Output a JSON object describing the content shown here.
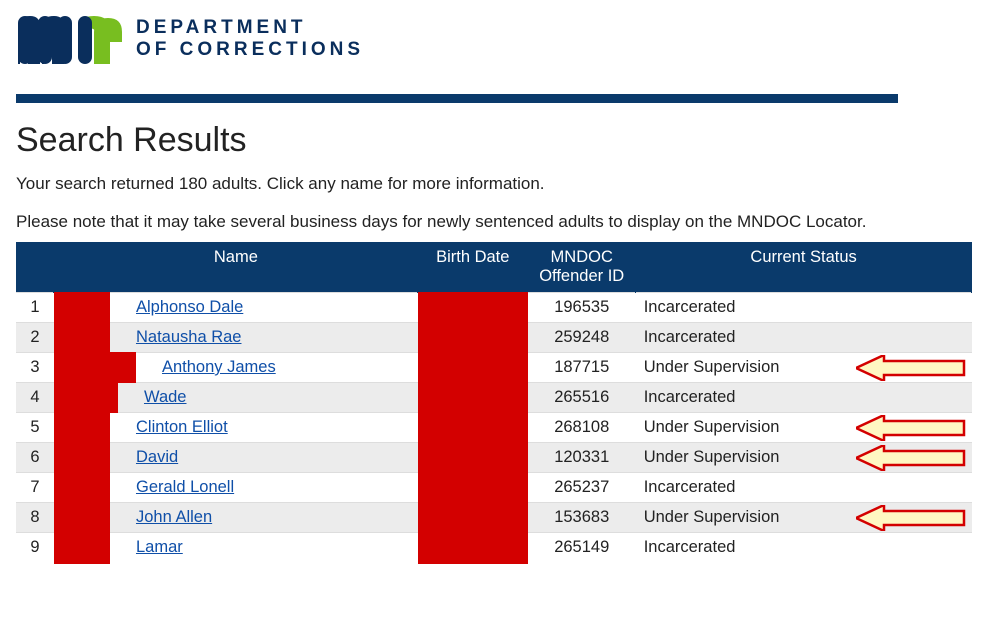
{
  "header": {
    "dept_line1": "DEPARTMENT",
    "dept_line2": "OF CORRECTIONS"
  },
  "page_title": "Search Results",
  "summary_text": "Your search returned 180 adults. Click any name for more information.",
  "note_text": "Please note that it may take several business days for newly sentenced adults to display on the MNDOC Locator.",
  "columns": {
    "name": "Name",
    "birth_date": "Birth Date",
    "offender_id": "MNDOC Offender ID",
    "status": "Current Status"
  },
  "rows": [
    {
      "n": "1",
      "name": "Alphonso Dale",
      "redact_w": 56,
      "link_ml": 74,
      "oid": "196535",
      "status": "Incarcerated",
      "arrow": false
    },
    {
      "n": "2",
      "name": "Natausha Rae",
      "redact_w": 56,
      "link_ml": 74,
      "oid": "259248",
      "status": "Incarcerated",
      "arrow": false
    },
    {
      "n": "3",
      "name": "Anthony James",
      "redact_w": 82,
      "link_ml": 100,
      "oid": "187715",
      "status": "Under Supervision",
      "arrow": true
    },
    {
      "n": "4",
      "name": "Wade",
      "redact_w": 64,
      "link_ml": 82,
      "oid": "265516",
      "status": "Incarcerated",
      "arrow": false
    },
    {
      "n": "5",
      "name": "Clinton Elliot",
      "redact_w": 56,
      "link_ml": 74,
      "oid": "268108",
      "status": "Under Supervision",
      "arrow": true
    },
    {
      "n": "6",
      "name": "David",
      "redact_w": 56,
      "link_ml": 74,
      "oid": "120331",
      "status": "Under Supervision",
      "arrow": true
    },
    {
      "n": "7",
      "name": "Gerald Lonell",
      "redact_w": 56,
      "link_ml": 74,
      "oid": "265237",
      "status": "Incarcerated",
      "arrow": false
    },
    {
      "n": "8",
      "name": "John Allen",
      "redact_w": 56,
      "link_ml": 74,
      "oid": "153683",
      "status": "Under Supervision",
      "arrow": true
    },
    {
      "n": "9",
      "name": "Lamar",
      "redact_w": 56,
      "link_ml": 74,
      "oid": "265149",
      "status": "Incarcerated",
      "arrow": false
    }
  ],
  "colors": {
    "brand_navy": "#0a3a6b",
    "brand_green": "#78be20",
    "redaction": "#d30000",
    "link": "#0f4fa8",
    "arrow_fill": "#fff7c2",
    "arrow_stroke": "#d30000"
  }
}
